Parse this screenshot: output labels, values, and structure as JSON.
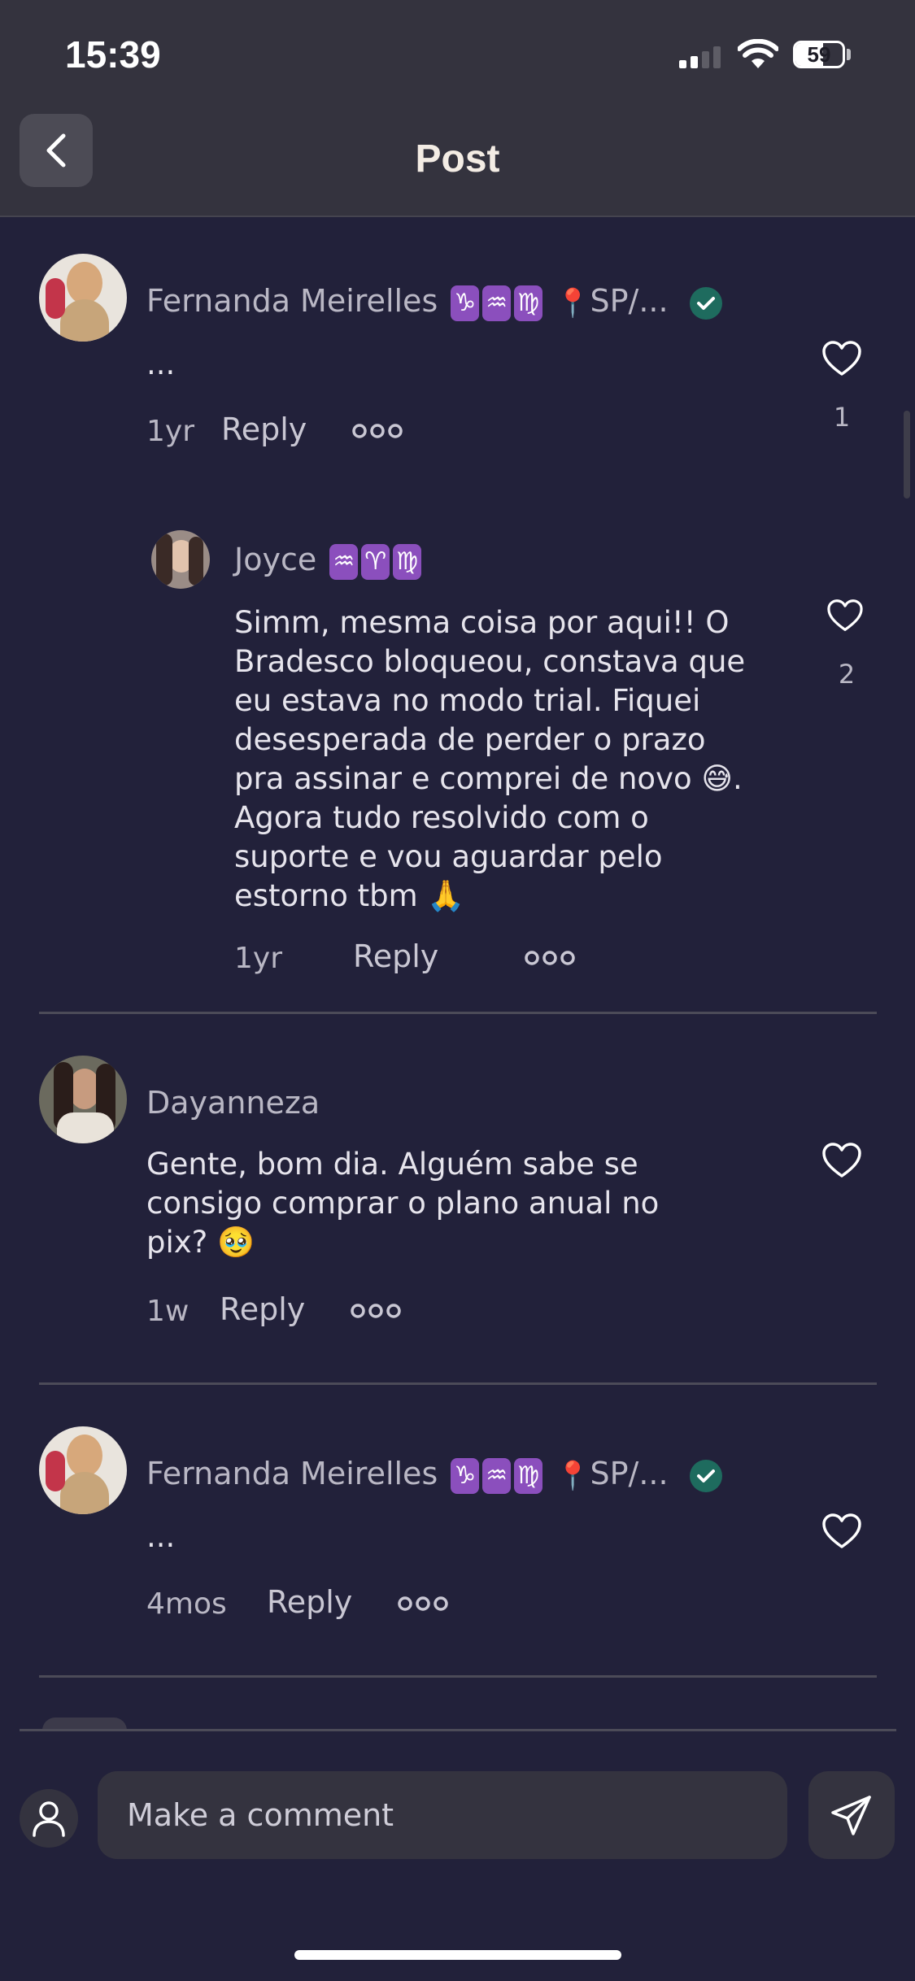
{
  "status_bar": {
    "time": "15:39",
    "battery": "59",
    "battery_level": 0.59
  },
  "header": {
    "title": "Post"
  },
  "comments": [
    {
      "name": "Fernanda Meirelles",
      "zodiac": [
        "♑",
        "♒",
        "♍"
      ],
      "location": "SP/...",
      "verified": true,
      "text": "...",
      "time": "1yr",
      "reply_label": "Reply",
      "likes": "1",
      "replies": [
        {
          "name": "Joyce",
          "zodiac": [
            "♒",
            "♈",
            "♍"
          ],
          "text_lines": [
            "Simm, mesma coisa por aqui!! O",
            "Bradesco bloqueou, constava que",
            "eu estava no modo trial. Fiquei",
            "desesperada de perder o prazo",
            "pra assinar e comprei de novo",
            "Agora tudo resolvido com o",
            "suporte e vou aguardar pelo",
            "estorno tbm"
          ],
          "emoji_after_line5": "😅",
          "emoji_after_line8": "🙏",
          "time": "1yr",
          "reply_label": "Reply",
          "likes": "2"
        }
      ]
    },
    {
      "name": "Dayanneza",
      "text_lines": [
        "Gente, bom dia. Alguém sabe se",
        "consigo comprar o plano anual no",
        "pix?"
      ],
      "emoji": "🥹",
      "time": "1w",
      "reply_label": "Reply"
    },
    {
      "name": "Fernanda Meirelles",
      "zodiac": [
        "♑",
        "♒",
        "♍"
      ],
      "location": "SP/...",
      "verified": true,
      "text": "...",
      "time": "4mos",
      "reply_label": "Reply"
    }
  ],
  "composer": {
    "placeholder": "Make a comment"
  },
  "colors": {
    "background": "#22213a",
    "header": "#34333e",
    "verified": "#1e6b5e",
    "zodiac_badge": "#8b4fbd"
  },
  "icons": [
    "back-chevron-icon",
    "heart-icon",
    "more-dots-icon",
    "verified-check-icon",
    "user-icon",
    "send-icon",
    "wifi-icon",
    "signal-icon",
    "battery-icon",
    "pin-icon"
  ]
}
